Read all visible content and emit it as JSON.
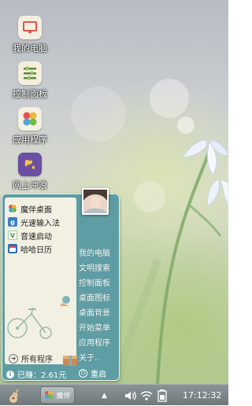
{
  "desktop_icons": [
    {
      "label": "我的电脑",
      "icon": "monitor-icon"
    },
    {
      "label": "控制面板",
      "icon": "control-panel-icon"
    },
    {
      "label": "应用程序",
      "icon": "apps-icon"
    },
    {
      "label": "网上冲浪",
      "icon": "globe-icon"
    }
  ],
  "start_menu": {
    "programs": [
      {
        "label": "魔伴桌面",
        "icon": "pinwheel-icon"
      },
      {
        "label": "光速输入法",
        "icon": "keyboard-g-icon"
      },
      {
        "label": "音速启动",
        "icon": "v-launcher-icon"
      },
      {
        "label": "哈哈日历",
        "icon": "calendar-icon"
      }
    ],
    "links": [
      "我的电脑",
      "文明搜索",
      "控制面板",
      "桌面图标",
      "桌面背景",
      "开始菜单",
      "应用程序",
      "关于.."
    ],
    "all_programs_label": "所有程序",
    "earned_label": "已赚：2.61元",
    "restart_label": "重启"
  },
  "taskbar": {
    "task_label": "魔伴",
    "tray_up_arrow": "▲",
    "clock": "17:12:32"
  },
  "colors": {
    "menu_bg": "#5e9da3",
    "left_panel_bg": "#f1f0e3",
    "taskbar_bg": "#7c8588"
  }
}
